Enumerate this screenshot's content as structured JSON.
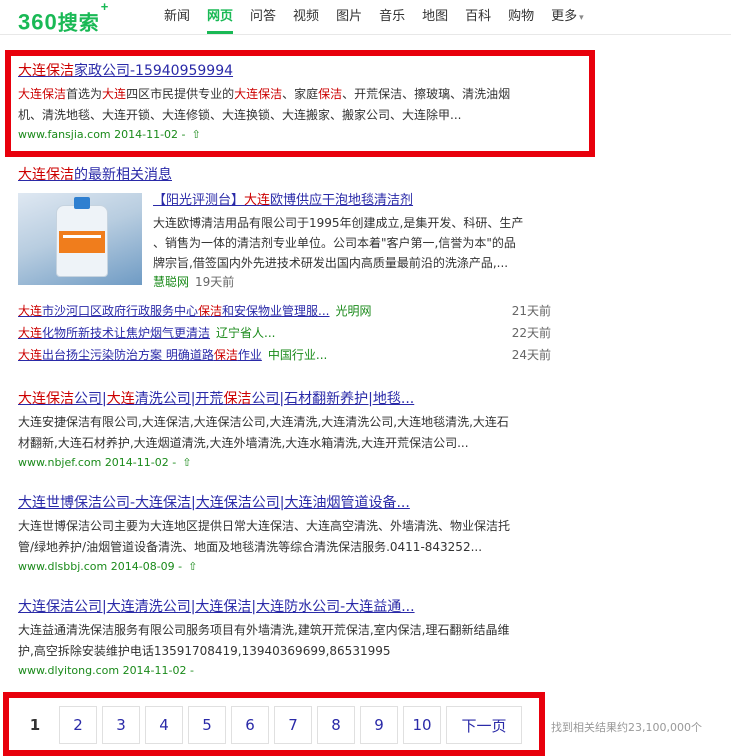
{
  "logo": {
    "text": "360",
    "text_cn": "搜索",
    "plus": "+"
  },
  "nav": [
    "新闻",
    "网页",
    "问答",
    "视频",
    "图片",
    "音乐",
    "地图",
    "百科",
    "购物",
    "更多"
  ],
  "nav_active": "网页",
  "results": [
    {
      "title_hl": "大连保洁",
      "title_rest": "家政公司-15940959994",
      "snippet_line1": [
        "大连",
        "保洁",
        "首选为",
        "大连",
        "四区市民提供专业的",
        "大连保洁",
        "、家庭",
        "保洁",
        "、开荒保洁、擦玻璃、清洗油烟"
      ],
      "snippet_line2": "机、清洗地毯、大连开锁、大连修锁、大连换锁、大连搬家、搬家公司、大连除甲...",
      "url": "www.fansjia.com 2014-11-02 -"
    },
    {
      "title_hl": "大连保洁",
      "title_rest": "的最新相关消息"
    },
    {
      "t1": "大连",
      "t2": "保洁",
      "t3": "公司|",
      "t4": "大连",
      "t5": "清洗公司|开荒",
      "t6": "保洁",
      "t7": "公司|石材翻新养护|地毯...",
      "snippet_line1": "大连安捷保洁有限公司,大连保洁,大连保洁公司,大连清洗,大连清洗公司,大连地毯清洗,大连石",
      "snippet_line2": "材翻新,大连石材养护,大连烟道清洗,大连外墙清洗,大连水箱清洗,大连开荒保洁公司...",
      "url": "www.nbjef.com 2014-11-02 -"
    },
    {
      "title": "大连世博保洁公司-大连保洁|大连保洁公司|大连油烟管道设备...",
      "snippet_line1": "大连世博保洁公司主要为大连地区提供日常大连保洁、大连高空清洗、外墙清洗、物业保洁托",
      "snippet_line2": "管/绿地养护/油烟管道设备清洗、地面及地毯清洗等综合清洗保洁服务.0411-843252...",
      "url": "www.dlsbbj.com 2014-08-09 -"
    },
    {
      "title": "大连保洁公司|大连清洗公司|大连保洁|大连防水公司-大连益通...",
      "snippet_line1": "大连益通清洗保洁服务有限公司服务项目有外墙清洗,建筑开荒保洁,室内保洁,理石翻新结晶维",
      "snippet_line2": "护,高空拆除安装维护电话13591708419,13940369699,86531995",
      "url": "www.dlyitong.com 2014-11-02 -"
    }
  ],
  "news": {
    "headline_pre": "【阳光评测台】",
    "headline_hl": "大连",
    "headline_rest": "欧博供应干泡地毯清洁剂",
    "snippet_line1": "大连欧博清洁用品有限公司于1995年创建成立,是集开发、科研、生产",
    "snippet_line2": "、销售为一体的清洁剂专业单位。公司本着\"客户第一,信誉为本\"的品",
    "snippet_line3": "牌宗旨,借签国内外先进技术研发出国内高质量最前沿的洗涤产品,...",
    "source": "慧聪网",
    "time": "19天前",
    "items": [
      {
        "hl1": "大连",
        "mid": "市沙河口区政府行政服务中心",
        "hl2": "保洁",
        "rest": "和安保物业管理服...",
        "src": "光明网",
        "time": "21天前"
      },
      {
        "hl1": "大连",
        "mid": "化物所新技术让焦炉烟气更清洁",
        "hl2": "",
        "rest": "",
        "src": "辽宁省人...",
        "time": "22天前"
      },
      {
        "hl1": "大连",
        "mid": "出台扬尘污染防治方案 明确道路",
        "hl2": "保洁",
        "rest": "作业",
        "src": "中国行业...",
        "time": "24天前"
      }
    ]
  },
  "pager": {
    "current": "1",
    "pages": [
      "2",
      "3",
      "4",
      "5",
      "6",
      "7",
      "8",
      "9",
      "10"
    ],
    "next": "下一页"
  },
  "total": "找到相关结果约23,100,000个",
  "colors": {
    "brand": "#19b955",
    "link": "#2a2aa8",
    "keyword": "#c00",
    "url": "#1a8a1a",
    "highlight_box": "#e8000c"
  },
  "icons": {
    "up": "up-arrow-icon"
  }
}
